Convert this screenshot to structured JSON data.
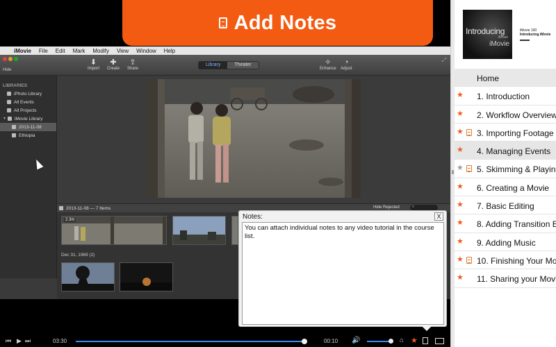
{
  "banner": {
    "title": "Add Notes",
    "icon": "document-icon",
    "color": "#f35b12"
  },
  "menubar": {
    "apple": "",
    "items": [
      "iMovie",
      "File",
      "Edit",
      "Mark",
      "Modify",
      "View",
      "Window",
      "Help"
    ]
  },
  "imovie_toolbar": {
    "hide_label": "Hide",
    "buttons": [
      {
        "label": "Import",
        "icon": "import-icon"
      },
      {
        "label": "Create",
        "icon": "create-icon"
      },
      {
        "label": "Share",
        "icon": "share-icon"
      },
      {
        "label": "Enhance",
        "icon": "enhance-icon"
      },
      {
        "label": "Adjust",
        "icon": "adjust-icon"
      }
    ],
    "segments": [
      "Library",
      "Theater"
    ],
    "active_segment": "Library"
  },
  "sidebar": {
    "heading": "LIBRARIES",
    "items": [
      "iPhoto Library",
      "All Events",
      "All Projects",
      "iMovie Library",
      "2013-11-08",
      "Ethiopia"
    ],
    "selected": "2013-11-08"
  },
  "browser": {
    "event_title": "2013-11-08 — 7 Items",
    "filter": "Hide Rejected",
    "clip_duration": "2.3m",
    "date_label": "Dec 31, 1969  (2)"
  },
  "notes": {
    "title": "Notes:",
    "close": "X",
    "text": "You can attach individual notes to any video tutorial in the course list."
  },
  "transport": {
    "elapsed": "03:30",
    "remaining": "00:10",
    "progress": 0.99,
    "volume": 0.95,
    "accent": "#3d8cf5"
  },
  "cover": {
    "title": "Introducing",
    "subtitle": "iMovie",
    "sub_small": "iMovie",
    "course_line1": "iMovie 100",
    "course_line2": "Introducing iMovie"
  },
  "toc": [
    {
      "label": "Home",
      "star": "none",
      "note": false,
      "home": true
    },
    {
      "label": "1. Introduction",
      "star": "orange",
      "note": false
    },
    {
      "label": "2. Workflow Overview",
      "star": "orange",
      "note": false
    },
    {
      "label": "3. Importing Footage",
      "star": "orange",
      "note": true
    },
    {
      "label": "4. Managing Events",
      "star": "orange",
      "note": false,
      "selected": true
    },
    {
      "label": "5. Skimming & Playing",
      "star": "gray",
      "note": true
    },
    {
      "label": "6. Creating a Movie",
      "star": "orange",
      "note": false
    },
    {
      "label": "7. Basic Editing",
      "star": "orange",
      "note": false
    },
    {
      "label": "8. Adding Transition E",
      "star": "orange",
      "note": false
    },
    {
      "label": "9. Adding Music",
      "star": "orange",
      "note": false
    },
    {
      "label": "10. Finishing Your Mov",
      "star": "orange",
      "note": true
    },
    {
      "label": "11. Sharing your Movi",
      "star": "orange",
      "note": false
    }
  ],
  "colors": {
    "star_orange": "#f05a1e",
    "star_gray": "#9c9c9c"
  }
}
